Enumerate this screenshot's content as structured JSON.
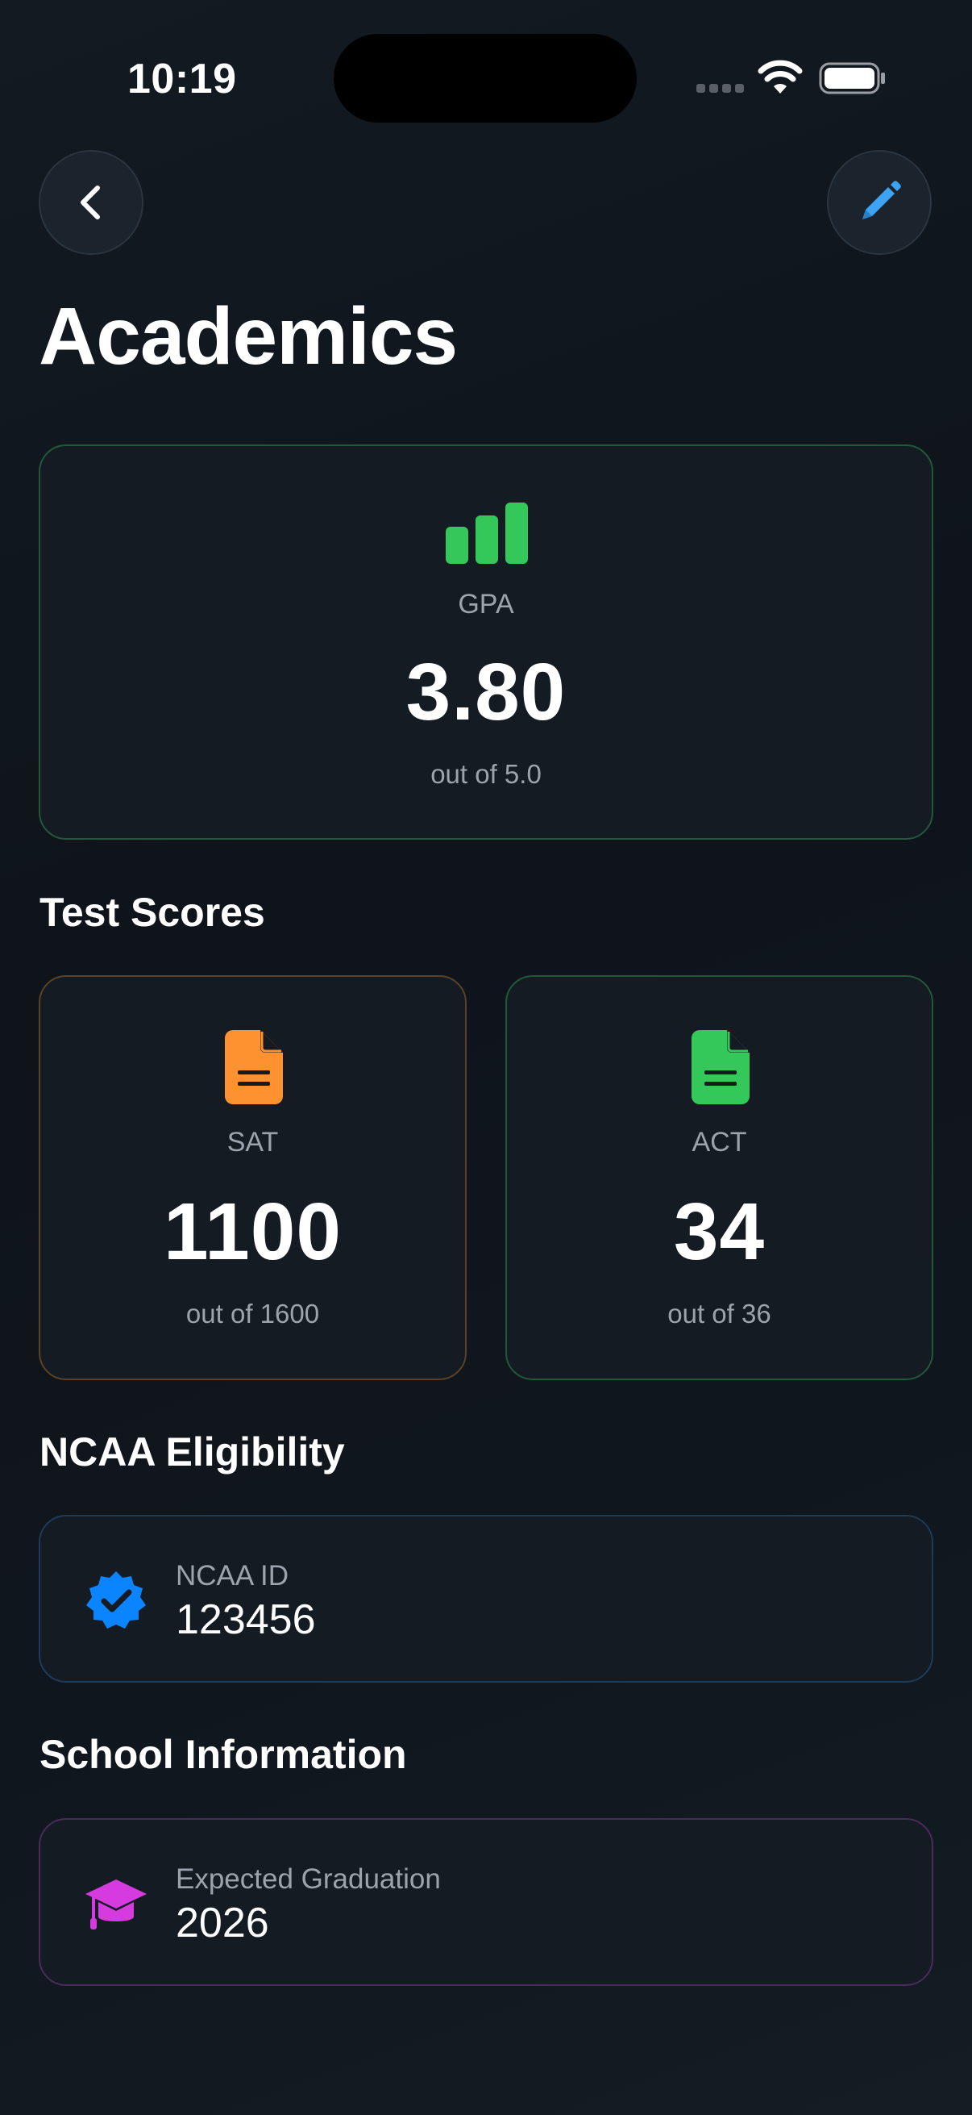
{
  "status_bar": {
    "time": "10:19"
  },
  "nav": {
    "back_icon": "chevron-left-icon",
    "edit_icon": "pencil-icon"
  },
  "page": {
    "title": "Academics"
  },
  "gpa": {
    "icon": "chart-bar-icon",
    "label": "GPA",
    "value": "3.80",
    "subtext": "out of 5.0",
    "accent": "#34c759"
  },
  "test_scores": {
    "section_title": "Test Scores",
    "sat": {
      "icon": "document-icon",
      "label": "SAT",
      "value": "1100",
      "subtext": "out of 1600",
      "accent": "#ff9230"
    },
    "act": {
      "icon": "document-icon",
      "label": "ACT",
      "value": "34",
      "subtext": "out of 36",
      "accent": "#34c759"
    }
  },
  "ncaa": {
    "section_title": "NCAA Eligibility",
    "icon": "verified-badge-icon",
    "label": "NCAA ID",
    "value": "123456",
    "accent": "#0a84ff"
  },
  "school": {
    "section_title": "School Information",
    "icon": "graduation-cap-icon",
    "label": "Expected Graduation",
    "value": "2026",
    "accent": "#d63be0"
  }
}
